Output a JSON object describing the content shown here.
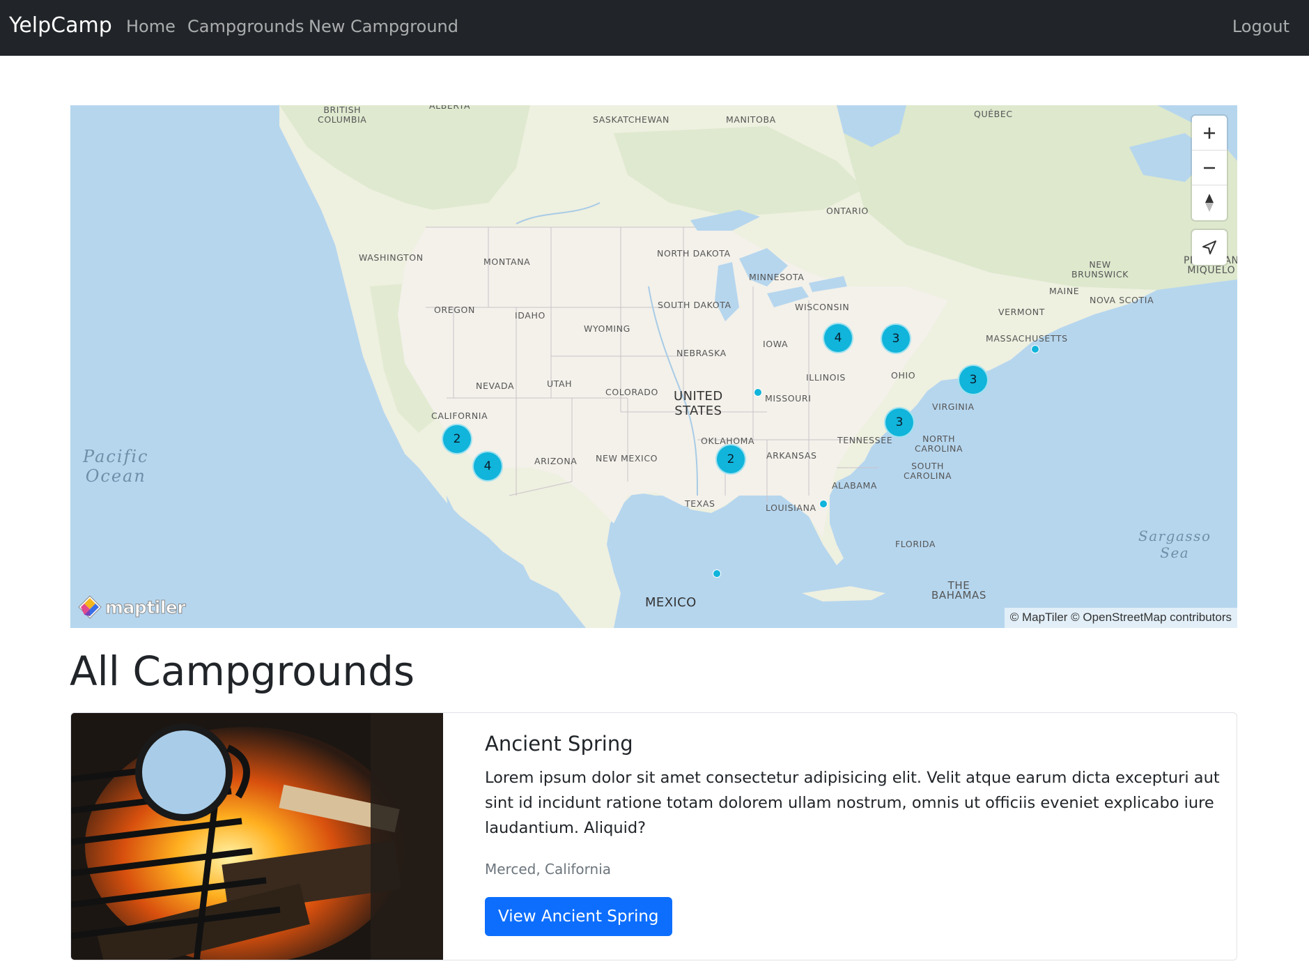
{
  "navbar": {
    "brand": "YelpCamp",
    "links": [
      {
        "label": "Home"
      },
      {
        "label": "Campgrounds"
      },
      {
        "label": "New Campground"
      }
    ],
    "logout": "Logout"
  },
  "map": {
    "labels": {
      "british_columbia": "BRITISH\nCOLUMBIA",
      "alberta": "ALBERTA",
      "saskatchewan": "SASKATCHEWAN",
      "manitoba": "MANITOBA",
      "quebec": "QUÉBEC",
      "ontario": "ONTARIO",
      "washington": "WASHINGTON",
      "montana": "MONTANA",
      "north_dakota": "NORTH DAKOTA",
      "minnesota": "MINNESOTA",
      "new_brunswick": "NEW\nBRUNSWICK",
      "pierre_miquelon": "PIERRE AN\nMIQUELO",
      "maine": "MAINE",
      "nova_scotia": "NOVA SCOTIA",
      "oregon": "OREGON",
      "idaho": "IDAHO",
      "south_dakota": "SOUTH DAKOTA",
      "wisconsin": "WISCONSIN",
      "vermont": "VERMONT",
      "wyoming": "WYOMING",
      "massachusetts": "MASSACHUSETTS",
      "iowa": "IOWA",
      "nebraska": "NEBRASKA",
      "nevada": "NEVADA",
      "utah": "UTAH",
      "colorado": "COLORADO",
      "united_states": "UNITED\nSTATES",
      "illinois": "ILLINOIS",
      "ohio": "OHIO",
      "missouri": "MISSOURI",
      "virginia": "VIRGINIA",
      "california": "CALIFORNIA",
      "oklahoma": "OKLAHOMA",
      "tennessee": "TENNESSEE",
      "north_carolina": "NORTH\nCAROLINA",
      "arkansas": "ARKANSAS",
      "arizona": "ARIZONA",
      "new_mexico": "NEW MEXICO",
      "south_carolina": "SOUTH\nCAROLINA",
      "alabama": "ALABAMA",
      "texas": "TEXAS",
      "louisiana": "LOUISIANA",
      "florida": "FLORIDA",
      "mexico": "MEXICO",
      "bahamas": "THE\nBAHAMAS",
      "pacific_ocean": "Pacific\nOcean",
      "sargasso_sea": "Sargasso\nSea"
    },
    "clusters": [
      {
        "count": "4"
      },
      {
        "count": "3"
      },
      {
        "count": "3"
      },
      {
        "count": "3"
      },
      {
        "count": "2"
      },
      {
        "count": "4"
      },
      {
        "count": "2"
      }
    ],
    "logo_text": "maptiler",
    "attribution": "© MapTiler © OpenStreetMap contributors",
    "colors": {
      "water": "#b6d6ee",
      "land": "#f2efe8",
      "cluster": "#11b4da"
    }
  },
  "page": {
    "title": "All Campgrounds"
  },
  "campgrounds": [
    {
      "title": "Ancient Spring",
      "description": "Lorem ipsum dolor sit amet consectetur adipisicing elit. Velit atque earum dicta excepturi aut sint id incidunt ratione totam dolorem ullam nostrum, omnis ut officiis eveniet explicabo iure laudantium. Aliquid?",
      "location": "Merced, California",
      "button": "View Ancient Spring"
    }
  ]
}
